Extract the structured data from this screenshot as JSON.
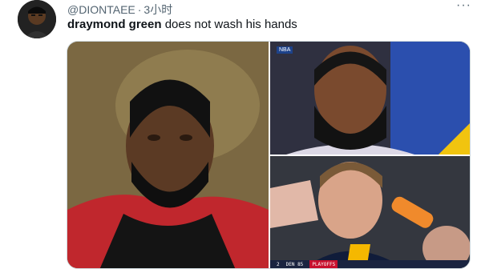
{
  "tweet": {
    "author_handle": "@DIONTAEE",
    "separator": "·",
    "time": "3小时",
    "more_icon": "ellipsis-icon",
    "text_bold": "draymond green",
    "text_rest": " does not wash his hands"
  },
  "media": {
    "photo_count": 3,
    "top_right_bug": "NBA",
    "scorebar": {
      "home": "2",
      "score": "DEN  85",
      "playoffs": "PLAYOFFS"
    }
  },
  "colors": {
    "text_primary": "#0f1419",
    "text_secondary": "#536471",
    "border": "#cfd9de"
  }
}
